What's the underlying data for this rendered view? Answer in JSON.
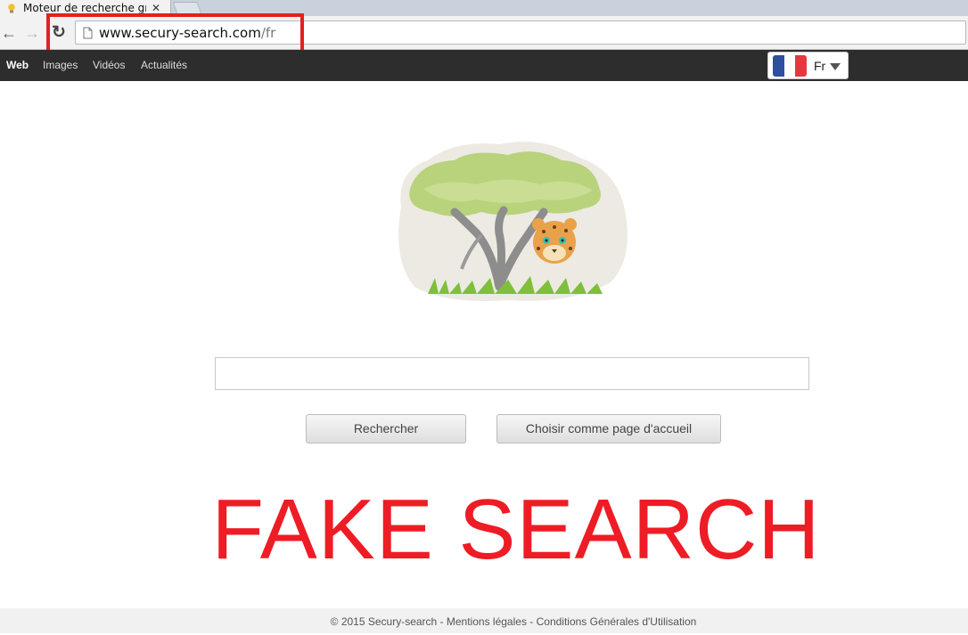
{
  "browser": {
    "tab_title": "Moteur de recherche grat",
    "tab_close": "✕",
    "url_host": "www.secury-search.com",
    "url_path": "/fr"
  },
  "nav": {
    "items": [
      "Web",
      "Images",
      "Vidéos",
      "Actualités"
    ],
    "language": "Fr",
    "flag_colors": [
      "#2e4fa0",
      "#ffffff",
      "#e8353e"
    ]
  },
  "search": {
    "placeholder": "",
    "search_label": "Rechercher",
    "homepage_label": "Choisir comme page d'accueil"
  },
  "overlay": {
    "text": "FAKE SEARCH",
    "color": "#ee1c25"
  },
  "footer": {
    "text": "© 2015 Secury-search - Mentions légales - Conditions Générales d'Utilisation"
  }
}
